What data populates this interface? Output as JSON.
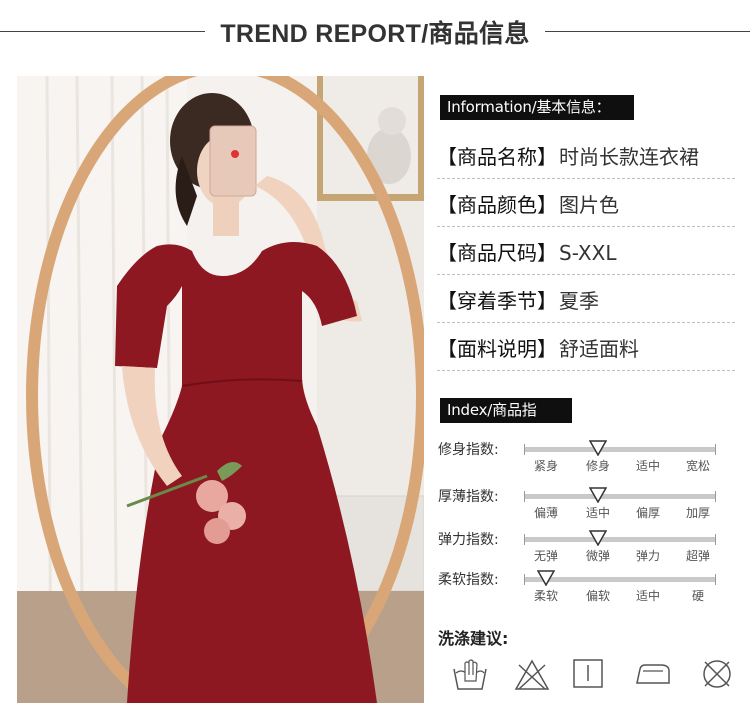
{
  "header": {
    "title": "TREND REPORT/商品信息"
  },
  "info": {
    "tag": "Information/基本信息：",
    "rows": [
      {
        "key": "【商品名称】",
        "value": "时尚长款连衣裙"
      },
      {
        "key": "【商品颜色】",
        "value": "图片色"
      },
      {
        "key": "【商品尺码】",
        "value": "S-XXL"
      },
      {
        "key": "【穿着季节】",
        "value": "夏季"
      },
      {
        "key": "【面料说明】",
        "value": "舒适面料"
      }
    ]
  },
  "index": {
    "tag": "Index/商品指数：",
    "sliders": [
      {
        "label": "修身指数:",
        "ticks": [
          "紧身",
          "修身",
          "适中",
          "宽松"
        ],
        "selected": 1
      },
      {
        "label": "厚薄指数:",
        "ticks": [
          "偏薄",
          "适中",
          "偏厚",
          "加厚"
        ],
        "selected": 1
      },
      {
        "label": "弹力指数:",
        "ticks": [
          "无弹",
          "微弹",
          "弹力",
          "超弹"
        ],
        "selected": 1
      },
      {
        "label": "柔软指数:",
        "ticks": [
          "柔软",
          "偏软",
          "适中",
          "硬"
        ],
        "selected": 0
      }
    ]
  },
  "wash": {
    "title": "洗涤建议:",
    "icons": [
      "hand-wash-icon",
      "no-bleach-icon",
      "line-dry-icon",
      "iron-icon",
      "no-dry-clean-icon"
    ]
  },
  "colors": {
    "dress": "#8e1822",
    "tag_bg": "#0f0f0f",
    "track": "#c9c9c9",
    "mirror_frame": "#d9a777"
  }
}
